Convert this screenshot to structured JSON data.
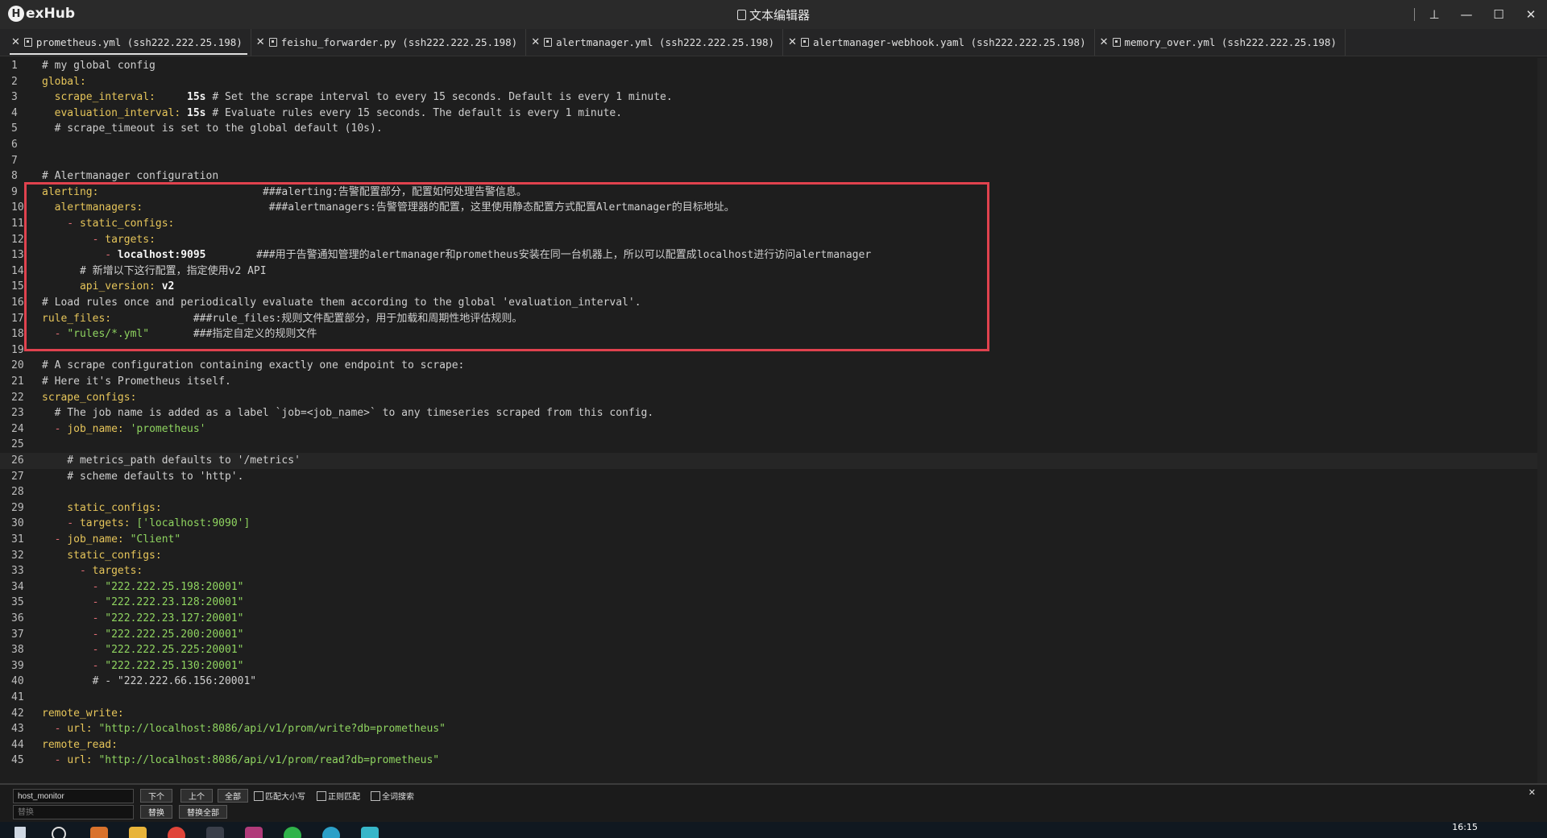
{
  "app": {
    "logo_letter": "H",
    "logo_text": "exHub",
    "window_title": "文本编辑器",
    "controls": {
      "pin": "⊥",
      "pin2": "📌",
      "minimize": "—",
      "maximize": "☐",
      "close": "✕"
    }
  },
  "tabs": [
    {
      "label": "prometheus.yml (ssh222.222.25.198)",
      "active": true
    },
    {
      "label": "feishu_forwarder.py (ssh222.222.25.198)",
      "active": false
    },
    {
      "label": "alertmanager.yml (ssh222.222.25.198)",
      "active": false
    },
    {
      "label": "alertmanager-webhook.yaml (ssh222.222.25.198)",
      "active": false
    },
    {
      "label": "memory_over.yml (ssh222.222.25.198)",
      "active": false
    }
  ],
  "editor": {
    "current_line": 26,
    "lines": [
      [
        [
          "c",
          "# my global config"
        ]
      ],
      [
        [
          "k",
          "global:"
        ]
      ],
      [
        [
          "k",
          "  scrape_interval:"
        ],
        [
          "p",
          "     "
        ],
        [
          "v",
          "15s"
        ],
        [
          "c",
          " # Set the scrape interval to every 15 seconds. Default is every 1 minute."
        ]
      ],
      [
        [
          "k",
          "  evaluation_interval:"
        ],
        [
          "p",
          " "
        ],
        [
          "v",
          "15s"
        ],
        [
          "c",
          " # Evaluate rules every 15 seconds. The default is every 1 minute."
        ]
      ],
      [
        [
          "c",
          "  # scrape_timeout is set to the global default (10s)."
        ]
      ],
      [],
      [],
      [
        [
          "c",
          "# Alertmanager configuration"
        ]
      ],
      [
        [
          "k",
          "alerting:"
        ],
        [
          "p",
          "                          "
        ],
        [
          "c",
          "###alerting:告警配置部分，配置如何处理告警信息。"
        ]
      ],
      [
        [
          "k",
          "  alertmanagers:"
        ],
        [
          "p",
          "                    "
        ],
        [
          "c",
          "###alertmanagers:告警管理器的配置，这里使用静态配置方式配置Alertmanager的目标地址。"
        ]
      ],
      [
        [
          "d",
          "    - "
        ],
        [
          "k",
          "static_configs:"
        ]
      ],
      [
        [
          "d",
          "        - "
        ],
        [
          "k",
          "targets:"
        ]
      ],
      [
        [
          "d",
          "          - "
        ],
        [
          "v",
          "localhost:9095"
        ],
        [
          "p",
          "        "
        ],
        [
          "c",
          "###用于告警通知管理的alertmanager和prometheus安装在同一台机器上，所以可以配置成localhost进行访问alertmanager"
        ]
      ],
      [
        [
          "c",
          "      # 新增以下这行配置，指定使用v2 API"
        ]
      ],
      [
        [
          "k",
          "      api_version:"
        ],
        [
          "p",
          " "
        ],
        [
          "v",
          "v2"
        ]
      ],
      [
        [
          "c",
          "# Load rules once and periodically evaluate them according to the global 'evaluation_interval'."
        ]
      ],
      [
        [
          "k",
          "rule_files:"
        ],
        [
          "p",
          "             "
        ],
        [
          "c",
          "###rule_files:规则文件配置部分，用于加载和周期性地评估规则。"
        ]
      ],
      [
        [
          "d",
          "  - "
        ],
        [
          "s",
          "\"rules/*.yml\""
        ],
        [
          "p",
          "       "
        ],
        [
          "c",
          "###指定自定义的规则文件"
        ]
      ],
      [],
      [
        [
          "c",
          "# A scrape configuration containing exactly one endpoint to scrape:"
        ]
      ],
      [
        [
          "c",
          "# Here it's Prometheus itself."
        ]
      ],
      [
        [
          "k",
          "scrape_configs:"
        ]
      ],
      [
        [
          "c",
          "  # The job name is added as a label `job=<job_name>` to any timeseries scraped from this config."
        ]
      ],
      [
        [
          "d",
          "  - "
        ],
        [
          "k",
          "job_name:"
        ],
        [
          "p",
          " "
        ],
        [
          "s",
          "'prometheus'"
        ]
      ],
      [],
      [
        [
          "c",
          "    # metrics_path defaults to '/metrics'"
        ]
      ],
      [
        [
          "c",
          "    # scheme defaults to 'http'."
        ]
      ],
      [],
      [
        [
          "k",
          "    static_configs:"
        ]
      ],
      [
        [
          "d",
          "    - "
        ],
        [
          "k",
          "targets:"
        ],
        [
          "p",
          " "
        ],
        [
          "s",
          "['localhost:9090']"
        ]
      ],
      [
        [
          "d",
          "  - "
        ],
        [
          "k",
          "job_name:"
        ],
        [
          "p",
          " "
        ],
        [
          "s",
          "\"Client\""
        ]
      ],
      [
        [
          "k",
          "    static_configs:"
        ]
      ],
      [
        [
          "d",
          "      - "
        ],
        [
          "k",
          "targets:"
        ]
      ],
      [
        [
          "d",
          "        - "
        ],
        [
          "s",
          "\"222.222.25.198:20001\""
        ]
      ],
      [
        [
          "d",
          "        - "
        ],
        [
          "s",
          "\"222.222.23.128:20001\""
        ]
      ],
      [
        [
          "d",
          "        - "
        ],
        [
          "s",
          "\"222.222.23.127:20001\""
        ]
      ],
      [
        [
          "d",
          "        - "
        ],
        [
          "s",
          "\"222.222.25.200:20001\""
        ]
      ],
      [
        [
          "d",
          "        - "
        ],
        [
          "s",
          "\"222.222.25.225:20001\""
        ]
      ],
      [
        [
          "d",
          "        - "
        ],
        [
          "s",
          "\"222.222.25.130:20001\""
        ]
      ],
      [
        [
          "c",
          "        # - \"222.222.66.156:20001\""
        ]
      ],
      [],
      [
        [
          "k",
          "remote_write:"
        ]
      ],
      [
        [
          "d",
          "  - "
        ],
        [
          "k",
          "url:"
        ],
        [
          "p",
          " "
        ],
        [
          "s",
          "\"http://localhost:8086/api/v1/prom/write?db=prometheus\""
        ]
      ],
      [
        [
          "k",
          "remote_read:"
        ]
      ],
      [
        [
          "d",
          "  - "
        ],
        [
          "k",
          "url:"
        ],
        [
          "p",
          " "
        ],
        [
          "s",
          "\"http://localhost:8086/api/v1/prom/read?db=prometheus\""
        ]
      ]
    ]
  },
  "findbar": {
    "find_value": "host_monitor",
    "replace_placeholder": "替换",
    "next_label": "下个",
    "prev_label": "上个",
    "all_label": "全部",
    "replace_label": "替换",
    "replace_all_label": "替换全部",
    "match_case_label": "匹配大小写",
    "regex_label": "正则匹配",
    "whole_word_label": "全词搜索",
    "close_label": "✕"
  },
  "taskbar": {
    "clock": "16:15"
  },
  "colors": {
    "highlight_box": "#e0424e",
    "key": "#e6c55a",
    "string": "#8fd460"
  }
}
